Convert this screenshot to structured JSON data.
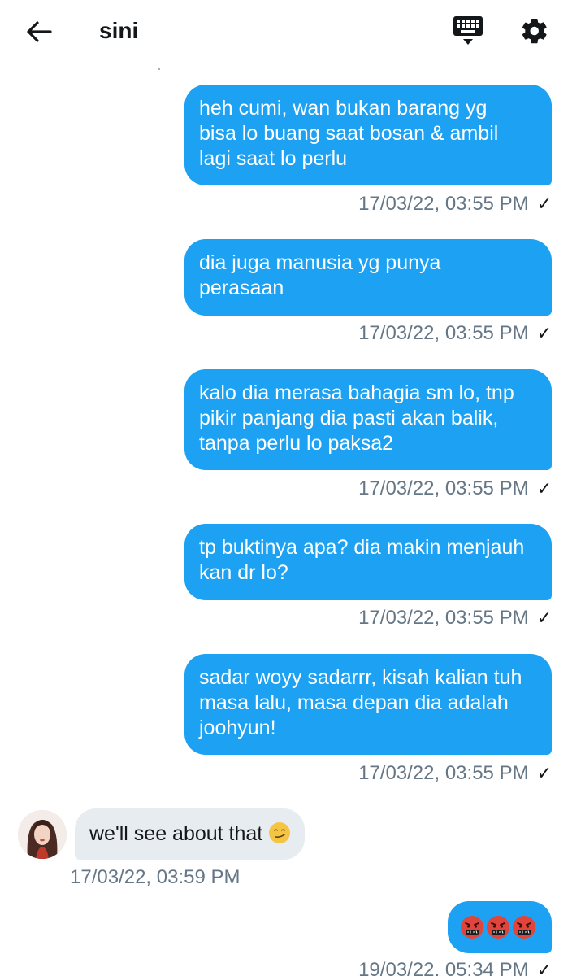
{
  "header": {
    "title": "sini",
    "back_icon": "arrow-left-icon",
    "keyboard_icon": "keyboard-icon",
    "settings_icon": "gear-icon"
  },
  "messages": [
    {
      "direction": "sent",
      "text": "heh cumi, wan bukan barang yg\nbisa lo buang saat bosan & ambil\nlagi saat lo perlu",
      "timestamp": "17/03/22, 03:55 PM",
      "status": "✓"
    },
    {
      "direction": "sent",
      "text": "dia juga manusia yg punya\nperasaan",
      "timestamp": "17/03/22, 03:55 PM",
      "status": "✓"
    },
    {
      "direction": "sent",
      "text": "kalo dia merasa bahagia sm lo, tnp\npikir panjang dia pasti akan balik,\ntanpa perlu lo paksa2",
      "timestamp": "17/03/22, 03:55 PM",
      "status": "✓"
    },
    {
      "direction": "sent",
      "text": "tp buktinya apa? dia makin menjauh\nkan dr lo?",
      "timestamp": "17/03/22, 03:55 PM",
      "status": "✓"
    },
    {
      "direction": "sent",
      "text": "sadar woyy sadarrr, kisah kalian tuh\nmasa lalu, masa depan dia adalah\njoohyun!",
      "timestamp": "17/03/22, 03:55 PM",
      "status": "✓"
    },
    {
      "direction": "received",
      "text": "we'll see about that",
      "emoji": "smirking-face",
      "timestamp": "17/03/22, 03:59 PM"
    },
    {
      "direction": "sent",
      "emoji": "angry-face-with-symbols x3",
      "timestamp": "19/03/22, 05:34 PM",
      "status": "✓"
    }
  ],
  "colors": {
    "sent_bubble": "#1da1f2",
    "received_bubble": "#e6ecf0",
    "meta_text": "#657786"
  }
}
